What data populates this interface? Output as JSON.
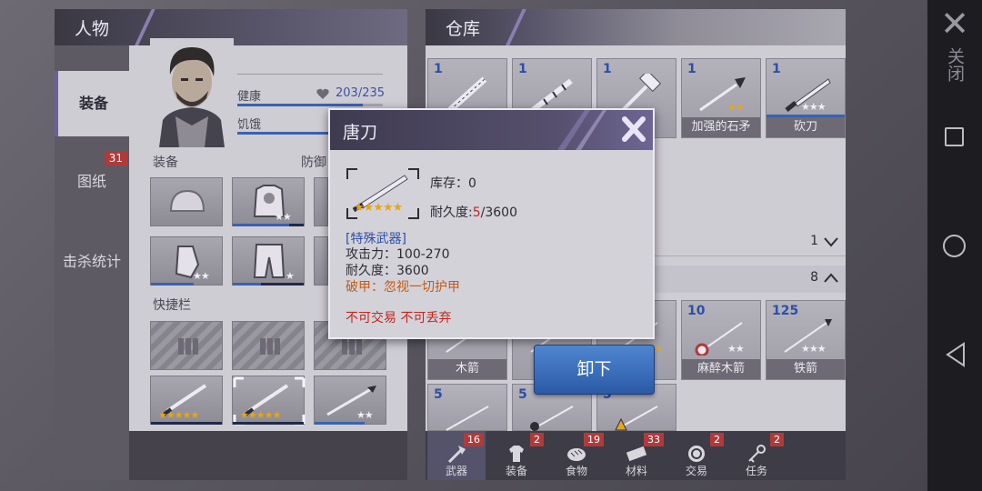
{
  "left_panel": {
    "title": "人物",
    "tabs": [
      {
        "label": "装备",
        "active": true
      },
      {
        "label": "图纸",
        "badge": "31"
      },
      {
        "label": "击杀统计"
      }
    ],
    "stats": {
      "health_label": "健康",
      "health_value": "203/235",
      "health_fraction": 0.864,
      "hunger_label": "饥饿"
    },
    "equip_label": "装备",
    "defense_label": "防御",
    "quickbar_label": "快捷栏"
  },
  "right_panel": {
    "title": "仓库",
    "row1": [
      {
        "count": "1",
        "name": ""
      },
      {
        "count": "1",
        "name": ""
      },
      {
        "count": "1",
        "name": ""
      },
      {
        "count": "1",
        "name": "加强的石矛"
      },
      {
        "count": "1",
        "name": "砍刀"
      }
    ],
    "group1_count": "1",
    "group2_count": "8",
    "row2": [
      {
        "count": "",
        "name": "木箭"
      },
      {
        "count": "",
        "name": ""
      },
      {
        "count": "",
        "name": ""
      },
      {
        "count": "10",
        "name": "麻醉木箭"
      },
      {
        "count": "125",
        "name": "铁箭"
      }
    ],
    "row3": [
      {
        "count": "5"
      },
      {
        "count": "5"
      },
      {
        "count": "5"
      }
    ],
    "bottom_tabs": [
      {
        "label": "武器",
        "badge": "16",
        "active": true,
        "icon": "axe-icon"
      },
      {
        "label": "装备",
        "badge": "2",
        "icon": "shirt-icon"
      },
      {
        "label": "食物",
        "badge": "19",
        "icon": "bread-icon"
      },
      {
        "label": "材料",
        "badge": "33",
        "icon": "plank-icon"
      },
      {
        "label": "交易",
        "badge": "2",
        "icon": "coin-icon"
      },
      {
        "label": "任务",
        "badge": "2",
        "icon": "key-icon"
      }
    ]
  },
  "popup": {
    "title": "唐刀",
    "stock_label": "库存：",
    "stock_value": "0",
    "durability_label": "耐久度:",
    "durability_current": "5",
    "durability_max": "/3600",
    "category": "[特殊武器]",
    "attack": "攻击力：100-270",
    "durability_line": "耐久度：3600",
    "armor_pierce": "破甲：忽视一切护甲",
    "restriction": "不可交易 不可丢弃",
    "stars": "★★★★★"
  },
  "unload_button": "卸下",
  "system_bar": {
    "close_label": "关闭"
  },
  "colors": {
    "accent": "#6b5fa0",
    "button_blue": "#2b5aa6",
    "badge_red": "#b03a3a",
    "star_gold": "#e3a622"
  }
}
